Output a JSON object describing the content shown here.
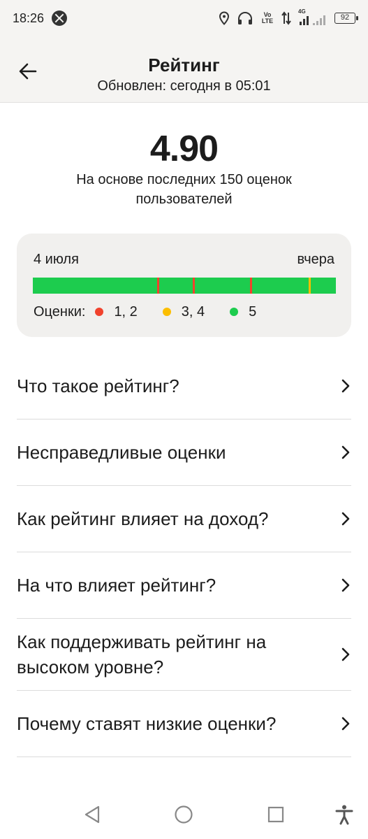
{
  "status_bar": {
    "time": "18:26",
    "network_label": "Vo LTE",
    "signal_label": "4G",
    "battery": "92",
    "icons": [
      "notification-icon",
      "location-icon",
      "headphones-icon",
      "data-arrows-icon",
      "signal-icon",
      "battery-icon"
    ]
  },
  "header": {
    "title": "Рейтинг",
    "subtitle": "Обновлен: сегодня в 05:01",
    "back_icon": "arrow-left-icon"
  },
  "rating": {
    "value": "4.90",
    "description": "На основе последних 150 оценок пользователей"
  },
  "history": {
    "from_label": "4 июля",
    "to_label": "вчера",
    "legend_title": "Оценки:",
    "legend": [
      {
        "label": "1, 2",
        "color": "#f1422d"
      },
      {
        "label": "3, 4",
        "color": "#fcbe00"
      },
      {
        "label": "5",
        "color": "#1dcc4e"
      }
    ],
    "bar_color": "#1dcc4e",
    "marks": [
      {
        "position": 0.41,
        "color": "#f1422d"
      },
      {
        "position": 0.528,
        "color": "#f1422d"
      },
      {
        "position": 0.717,
        "color": "#f1422d"
      },
      {
        "position": 0.91,
        "color": "#fcbe00"
      }
    ]
  },
  "menu": [
    {
      "label": "Что такое рейтинг?"
    },
    {
      "label": "Несправедливые оценки"
    },
    {
      "label": "Как рейтинг влияет на доход?"
    },
    {
      "label": "На что влияет рейтинг?"
    },
    {
      "label": "Как поддерживать рейтинг на высоком уровне?"
    },
    {
      "label": "Почему ставят низкие оценки?"
    }
  ],
  "nav_bar": {
    "icons": [
      "back-triangle-icon",
      "home-circle-icon",
      "recents-square-icon",
      "accessibility-icon"
    ]
  }
}
